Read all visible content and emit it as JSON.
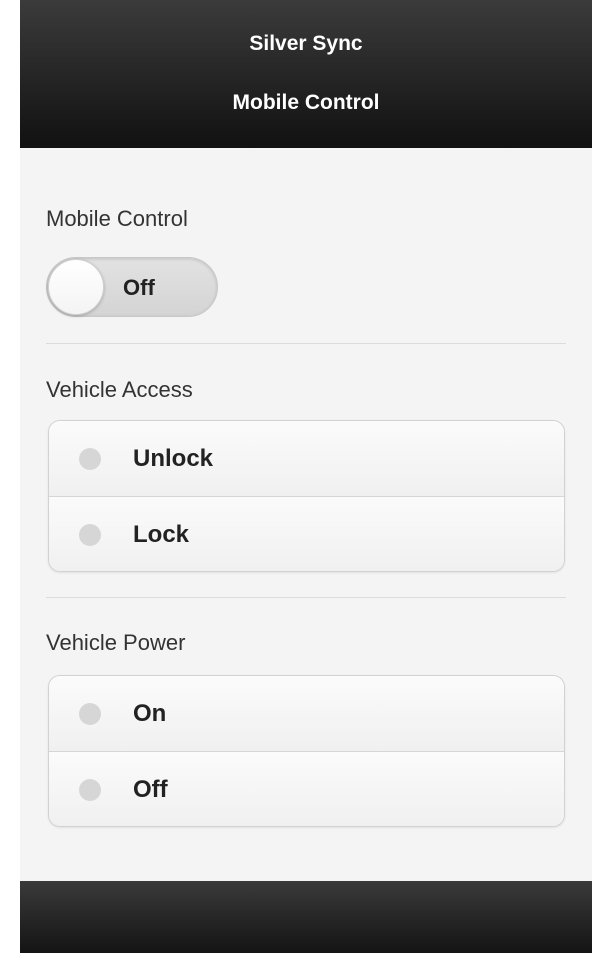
{
  "header": {
    "title": "Silver Sync",
    "subtitle": "Mobile Control"
  },
  "mobile_control": {
    "label": "Mobile Control",
    "toggle_state": "Off"
  },
  "vehicle_access": {
    "label": "Vehicle Access",
    "options": [
      {
        "label": "Unlock",
        "selected": false
      },
      {
        "label": "Lock",
        "selected": false
      }
    ]
  },
  "vehicle_power": {
    "label": "Vehicle Power",
    "options": [
      {
        "label": "On",
        "selected": false
      },
      {
        "label": "Off",
        "selected": false
      }
    ]
  },
  "colors": {
    "bar": "#1a1a1a",
    "background": "#f4f4f4",
    "radio_unselected": "#d6d6d6"
  }
}
